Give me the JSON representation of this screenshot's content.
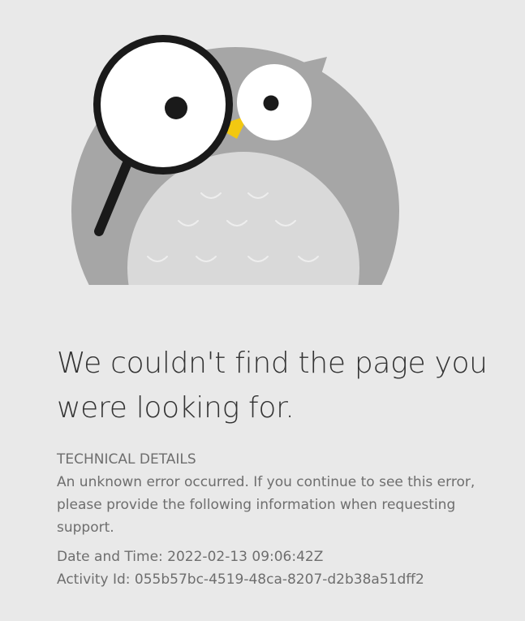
{
  "illustration": {
    "icon": "owl-with-magnifying-glass-icon",
    "colors": {
      "body": "#a6a6a6",
      "belly": "#d9d9d9",
      "eye_white": "#ffffff",
      "pupil": "#1a1a1a",
      "beak": "#f2c811",
      "magnifier_ring": "#1a1a1a"
    }
  },
  "error": {
    "heading": "We couldn't find the page you were looking for.",
    "technical_title": "TECHNICAL DETAILS",
    "message": "An unknown error occurred. If you continue to see this error, please provide the following information when requesting support.",
    "date_time_label": "Date and Time:",
    "date_time_value": "2022-02-13 09:06:42Z",
    "activity_id_label": "Activity Id:",
    "activity_id_value": "055b57bc-4519-48ca-8207-d2b38a51dff2"
  }
}
